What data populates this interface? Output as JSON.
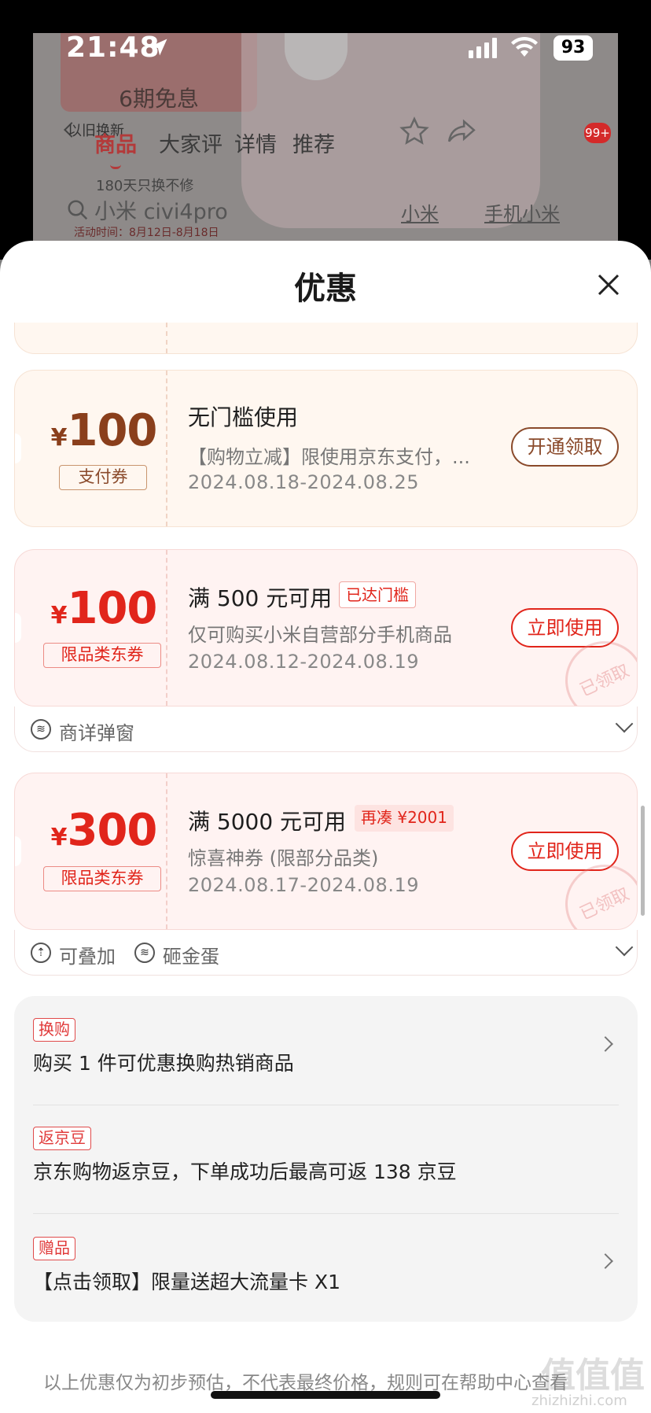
{
  "status_bar": {
    "time": "21:48",
    "battery": "93"
  },
  "background": {
    "promo_text": "6期免息",
    "promo_sub": "180天只换不修",
    "promo_date": "活动时间：8月12日-8月18日",
    "tabs": [
      {
        "label": "商品",
        "active": true
      },
      {
        "label": "大家评",
        "active": false
      },
      {
        "label": "详情",
        "active": false
      },
      {
        "label": "推荐",
        "active": false
      }
    ],
    "overlay_text": "以旧换新",
    "search_text": "小米 civi4pro",
    "links": [
      "小米",
      "手机小米"
    ],
    "cart_badge": "99+"
  },
  "sheet": {
    "title": "优惠"
  },
  "coupons": [
    {
      "currency": "¥",
      "amount": "100",
      "tag": "支付券",
      "title": "无门槛使用",
      "chip": "",
      "desc": "【购物立减】限使用京东支付，...",
      "date": "2024.08.18-2024.08.25",
      "button": "开通领取",
      "accent": "#8a4a2b"
    },
    {
      "currency": "¥",
      "amount": "100",
      "tag": "限品类东券",
      "title": "满 500 元可用",
      "chip": "已达门槛",
      "desc": "仅可购买小米自营部分手机商品",
      "date": "2024.08.12-2024.08.19",
      "button": "立即使用",
      "stamp": "已领取",
      "footer": [
        {
          "icon": "coupon-icon",
          "label": "商详弹窗"
        }
      ],
      "accent": "#e1251b"
    },
    {
      "currency": "¥",
      "amount": "300",
      "tag": "限品类东券",
      "title": "满 5000 元可用",
      "chip": "再凑 ¥2001",
      "desc": "惊喜神券 (限部分品类)",
      "date": "2024.08.17-2024.08.19",
      "button": "立即使用",
      "stamp": "已领取",
      "footer": [
        {
          "icon": "stack-icon",
          "label": "可叠加"
        },
        {
          "icon": "coupon-icon",
          "label": "砸金蛋"
        }
      ],
      "accent": "#e1251b"
    }
  ],
  "benefits": [
    {
      "tag": "换购",
      "text": "购买 1 件可优惠换购热销商品",
      "has_arrow": true
    },
    {
      "tag": "返京豆",
      "text": "京东购物返京豆，下单成功后最高可返 138 京豆",
      "has_arrow": false
    },
    {
      "tag": "赠品",
      "text": "【点击领取】限量送超大流量卡 X1",
      "has_arrow": true
    }
  ],
  "disclaimer": "以上优惠仅为初步预估，不代表最终价格，规则可在帮助中心查看",
  "watermark": {
    "main": "值值值",
    "sub": "zhizhizhi.com"
  }
}
